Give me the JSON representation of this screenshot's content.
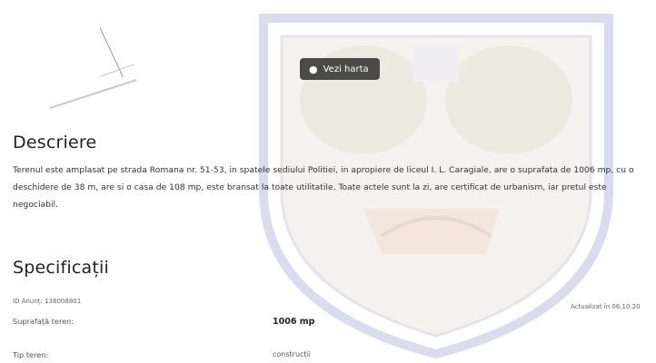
{
  "map": {
    "button_label": "Vezi harta",
    "pin_icon": "map-pin-icon"
  },
  "description": {
    "title": "Descriere",
    "text": "Terenul este amplasat pe strada Romana nr. 51-53, in spatele sediului Politiei, in apropiere de liceul I. L. Caragiale, are o suprafata de 1006 mp, cu o deschidere de 38 m, are si o casa de 108 mp, este bransat la toate utilitatile. Toate actele sunt la zi, are certificat de urbanism, iar pretul este negociabil."
  },
  "specs": {
    "title": "Specificații",
    "listing_id": "ID Anunț: 138008801",
    "updated": "Actualizat în 06.10.20",
    "rows": [
      {
        "label": "Suprafață teren:",
        "value": "1006 mp"
      },
      {
        "label": "Tip teren:",
        "value": "construcții"
      }
    ]
  }
}
